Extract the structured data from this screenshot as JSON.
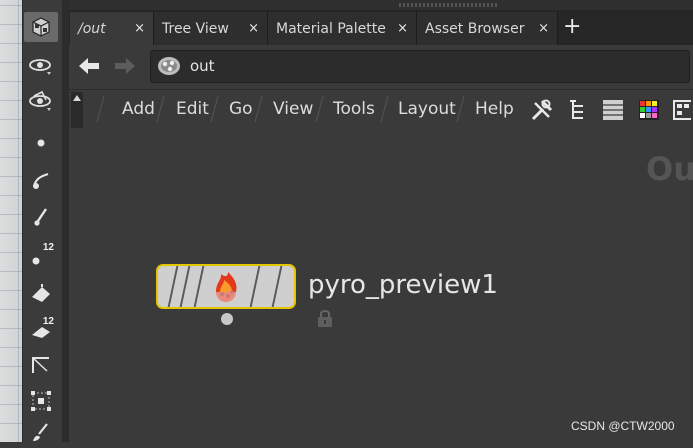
{
  "tabs": [
    {
      "label": "/out",
      "active": true,
      "close": "×"
    },
    {
      "label": "Tree View",
      "active": false,
      "close": "×"
    },
    {
      "label": "Material Palette",
      "active": false,
      "close": "×"
    },
    {
      "label": "Asset Browser",
      "active": false,
      "close": "×"
    }
  ],
  "tab_add": "+",
  "path": {
    "value": "out",
    "icon": "out-context-icon"
  },
  "menu": [
    "Add",
    "Edit",
    "Go",
    "View",
    "Tools",
    "Layout",
    "Help"
  ],
  "menu_tools": [
    "wrench-icon",
    "tree-icon",
    "list-view-icon",
    "color-palette-icon",
    "grid-view-icon"
  ],
  "network": {
    "partial_context_label": "Ou"
  },
  "node": {
    "name": "pyro_preview1",
    "icon": "fire-icon",
    "locked": true,
    "border_color": "#e5c400"
  },
  "shelf_tools": [
    {
      "icon": "select-tool-icon",
      "badge": ""
    },
    {
      "icon": "view-tool-icon",
      "badge": ""
    },
    {
      "icon": "handle-tool-icon",
      "badge": ""
    },
    {
      "icon": "point-icon",
      "badge": ""
    },
    {
      "icon": "curve-tool-icon",
      "badge": ""
    },
    {
      "icon": "brush-tool-icon",
      "badge": ""
    },
    {
      "icon": "point-number-icon",
      "badge": "12"
    },
    {
      "icon": "primitive-icon",
      "badge": ""
    },
    {
      "icon": "primitive-number-icon",
      "badge": "12"
    },
    {
      "icon": "edge-icon",
      "badge": ""
    },
    {
      "icon": "transform-icon",
      "badge": ""
    },
    {
      "icon": "paint-icon",
      "badge": ""
    }
  ],
  "watermark": "CSDN @CTW2000"
}
